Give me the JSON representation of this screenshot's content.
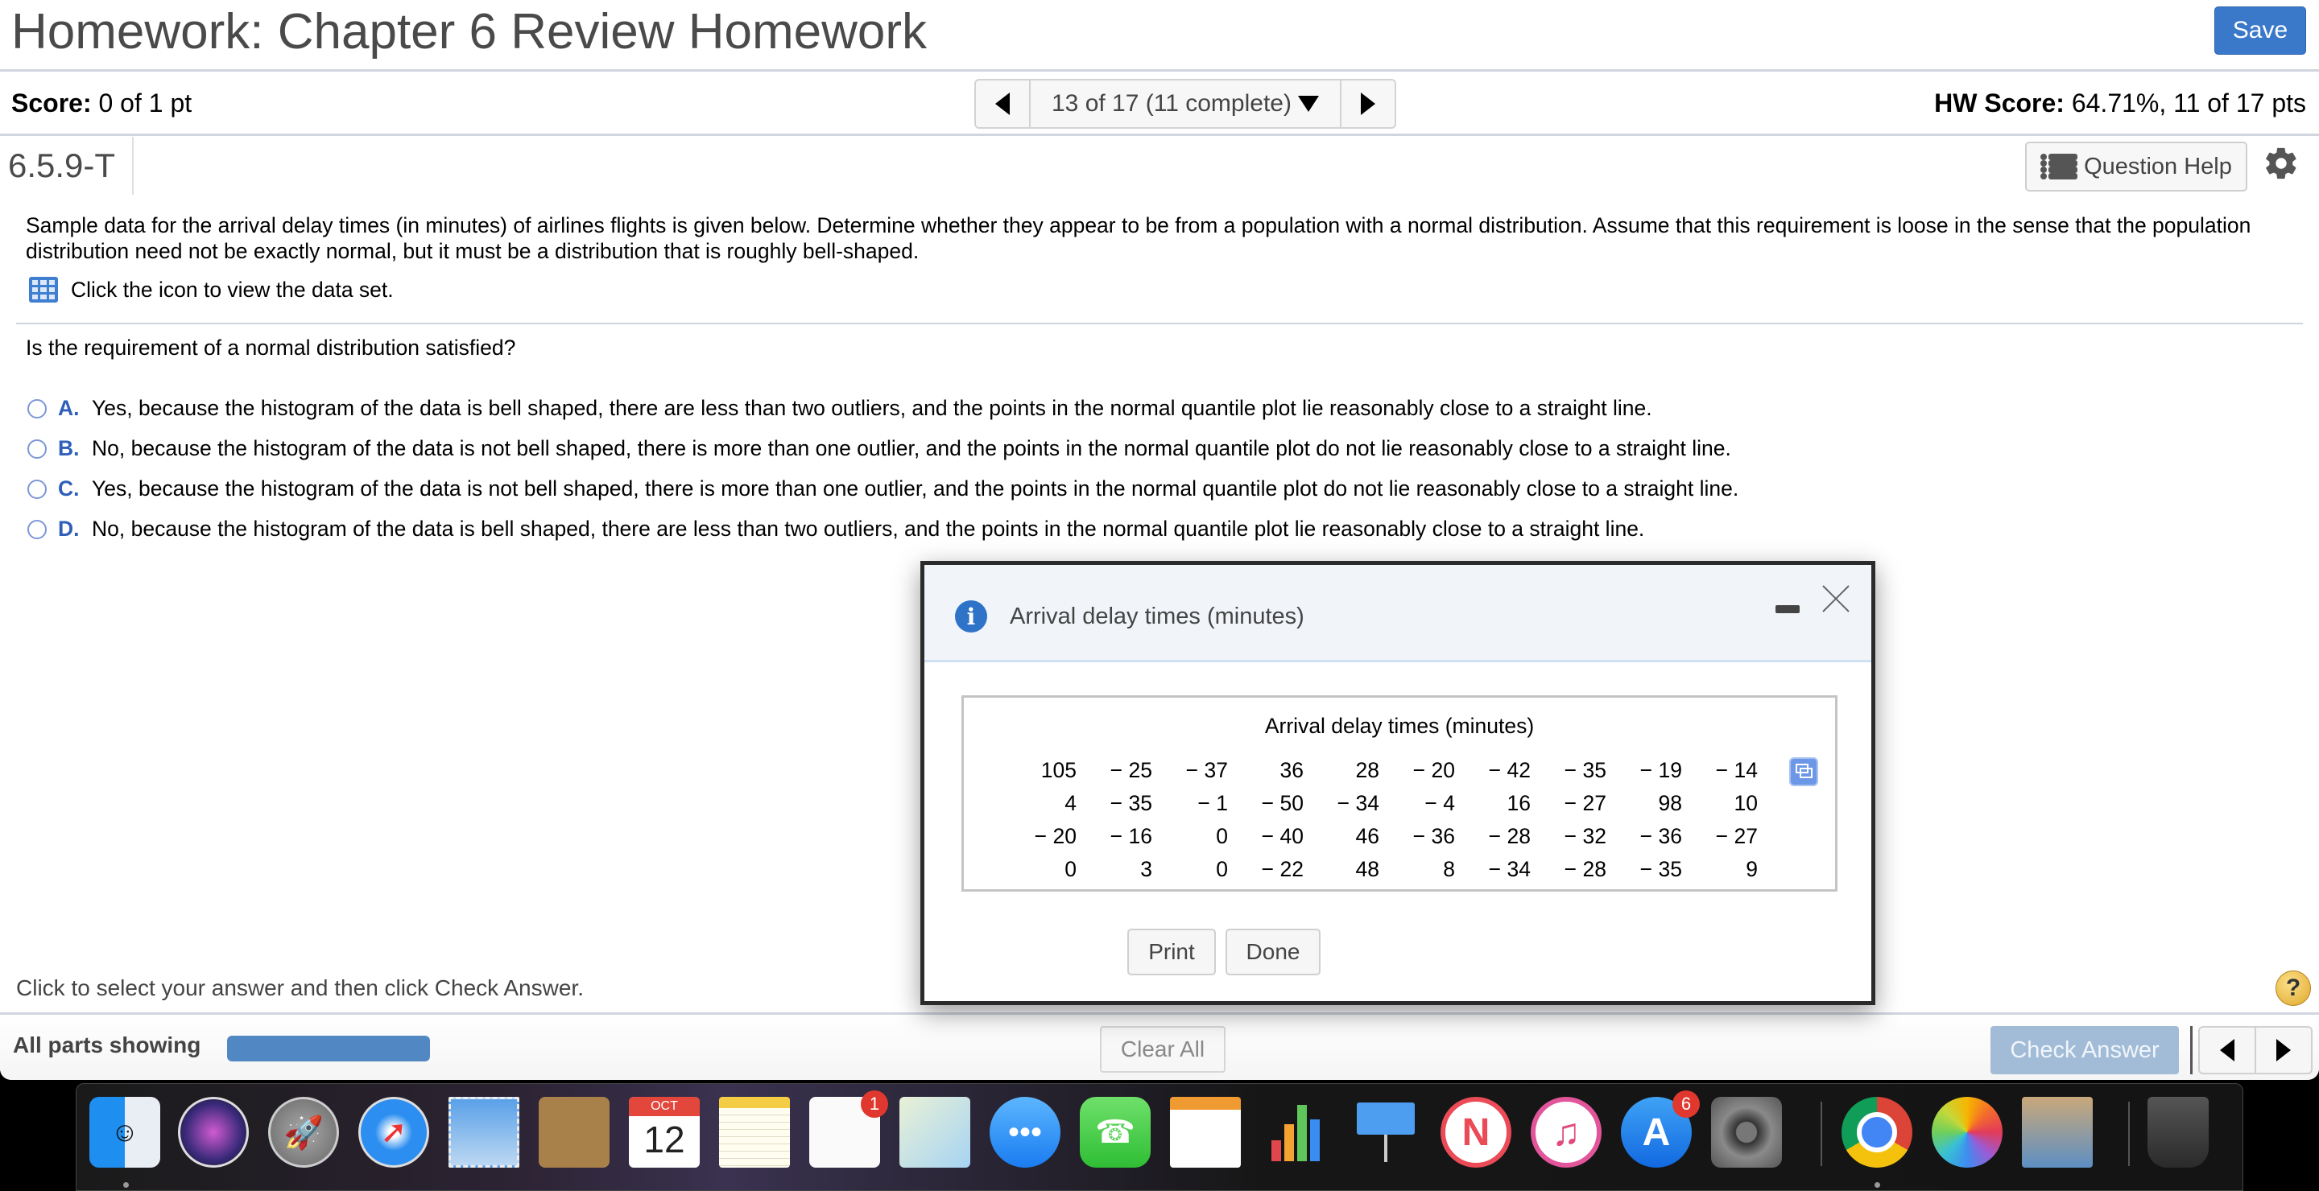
{
  "header": {
    "title": "Homework: Chapter 6 Review Homework",
    "save_label": "Save"
  },
  "score_row": {
    "score_label": "Score:",
    "score_value": " 0 of 1 pt",
    "question_nav": "13 of 17 (11 complete)",
    "hw_score_label": "HW Score:",
    "hw_score_value": " 64.71%, 11 of 17 pts"
  },
  "question": {
    "id": "6.5.9-T",
    "help_label": "Question Help",
    "text": "Sample data for the arrival delay times (in minutes) of airlines flights is given below. Determine whether they appear to be from a population with a normal distribution. Assume that this requirement is loose in the sense that the population distribution need not be exactly normal, but it must be a distribution that is roughly bell-shaped.",
    "dataset_link": "Click the icon to view the data set.",
    "prompt": "Is the requirement of a normal distribution satisfied?",
    "options": [
      {
        "letter": "A.",
        "text": "Yes, because the histogram of the data is bell shaped, there are less than two outliers, and the points in the normal quantile plot lie reasonably close to a straight line."
      },
      {
        "letter": "B.",
        "text": "No, because the histogram of the data is not bell shaped, there is more than one outlier, and the points in the normal quantile plot do not lie reasonably close to a straight line."
      },
      {
        "letter": "C.",
        "text": "Yes, because the histogram of the data is not bell shaped, there is more than one outlier, and the points in the normal quantile plot do not lie reasonably close to a straight line."
      },
      {
        "letter": "D.",
        "text": "No, because the histogram of the data is bell shaped, there are less than two outliers, and the points in the normal quantile plot lie reasonably close to a straight line."
      }
    ],
    "instruction": "Click to select your answer and then click Check Answer."
  },
  "footer": {
    "parts_label": "All parts showing",
    "progress_fraction": 1.0,
    "clear_all_label": "Clear All",
    "check_answer_label": "Check Answer"
  },
  "dialog": {
    "title": "Arrival delay times (minutes)",
    "table_title": "Arrival delay times (minutes)",
    "rows": [
      [
        "105",
        "− 25",
        "− 37",
        "36",
        "28",
        "− 20",
        "− 42",
        "− 35",
        "− 19",
        "− 14"
      ],
      [
        "4",
        "− 35",
        "− 1",
        "− 50",
        "− 34",
        "− 4",
        "16",
        "− 27",
        "98",
        "10"
      ],
      [
        "− 20",
        "− 16",
        "0",
        "− 40",
        "46",
        "− 36",
        "− 28",
        "− 32",
        "− 36",
        "− 27"
      ],
      [
        "0",
        "3",
        "0",
        "− 22",
        "48",
        "8",
        "− 34",
        "− 28",
        "− 35",
        "9"
      ]
    ],
    "print_label": "Print",
    "done_label": "Done"
  },
  "dock": {
    "calendar_month": "OCT",
    "calendar_day": "12",
    "reminders_badge": "1",
    "appstore_badge": "6",
    "apps": [
      "Finder",
      "Siri",
      "Launchpad",
      "Safari",
      "Mail",
      "Contacts",
      "Calendar",
      "Notes",
      "Reminders",
      "Maps",
      "Messages",
      "FaceTime",
      "Pages",
      "Numbers",
      "Keynote",
      "News",
      "Music",
      "App Store",
      "System Preferences",
      "Chrome",
      "Photos",
      "Preview",
      "Trash"
    ]
  },
  "colors": {
    "accent": "#3a78c9",
    "option_letter": "#2f5fb8",
    "check_answer_disabled": "#a2bcd8",
    "progress": "#5188c4"
  }
}
